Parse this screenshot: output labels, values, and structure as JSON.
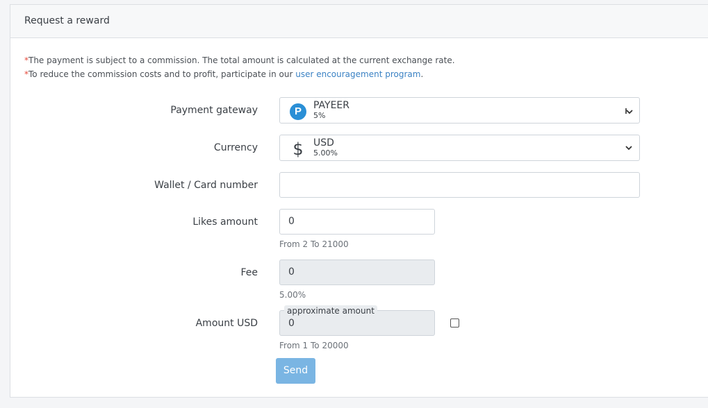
{
  "card": {
    "title": "Request a reward"
  },
  "notes": {
    "star": "*",
    "line1": "The payment is subject to a commission. The total amount is calculated at the current exchange rate.",
    "line2_prefix": "To reduce the commission costs and to profit, participate in our ",
    "line2_link": "user encouragement program",
    "line2_suffix": "."
  },
  "form": {
    "payment_gateway": {
      "label": "Payment gateway",
      "selected": "PAYEER",
      "sub": "5%",
      "icon": "payeer-logo-icon",
      "icon_letter": "P",
      "icon_color": "#2a8fd6"
    },
    "currency": {
      "label": "Currency",
      "selected": "USD",
      "sub": "5.00%",
      "icon": "dollar-icon",
      "icon_glyph": "$"
    },
    "wallet": {
      "label": "Wallet / Card number",
      "value": ""
    },
    "likes": {
      "label": "Likes amount",
      "value": "0",
      "hint": "From 2 To 21000"
    },
    "fee": {
      "label": "Fee",
      "value": "0",
      "hint": "5.00%"
    },
    "amount": {
      "label": "Amount USD",
      "badge": "approximate amount",
      "value": "0",
      "hint": "From 1 To 20000"
    },
    "send_label": "Send"
  },
  "colors": {
    "accent": "#3b82c4",
    "required_star": "#e64b3c",
    "send_button": "#7ab5e3"
  }
}
